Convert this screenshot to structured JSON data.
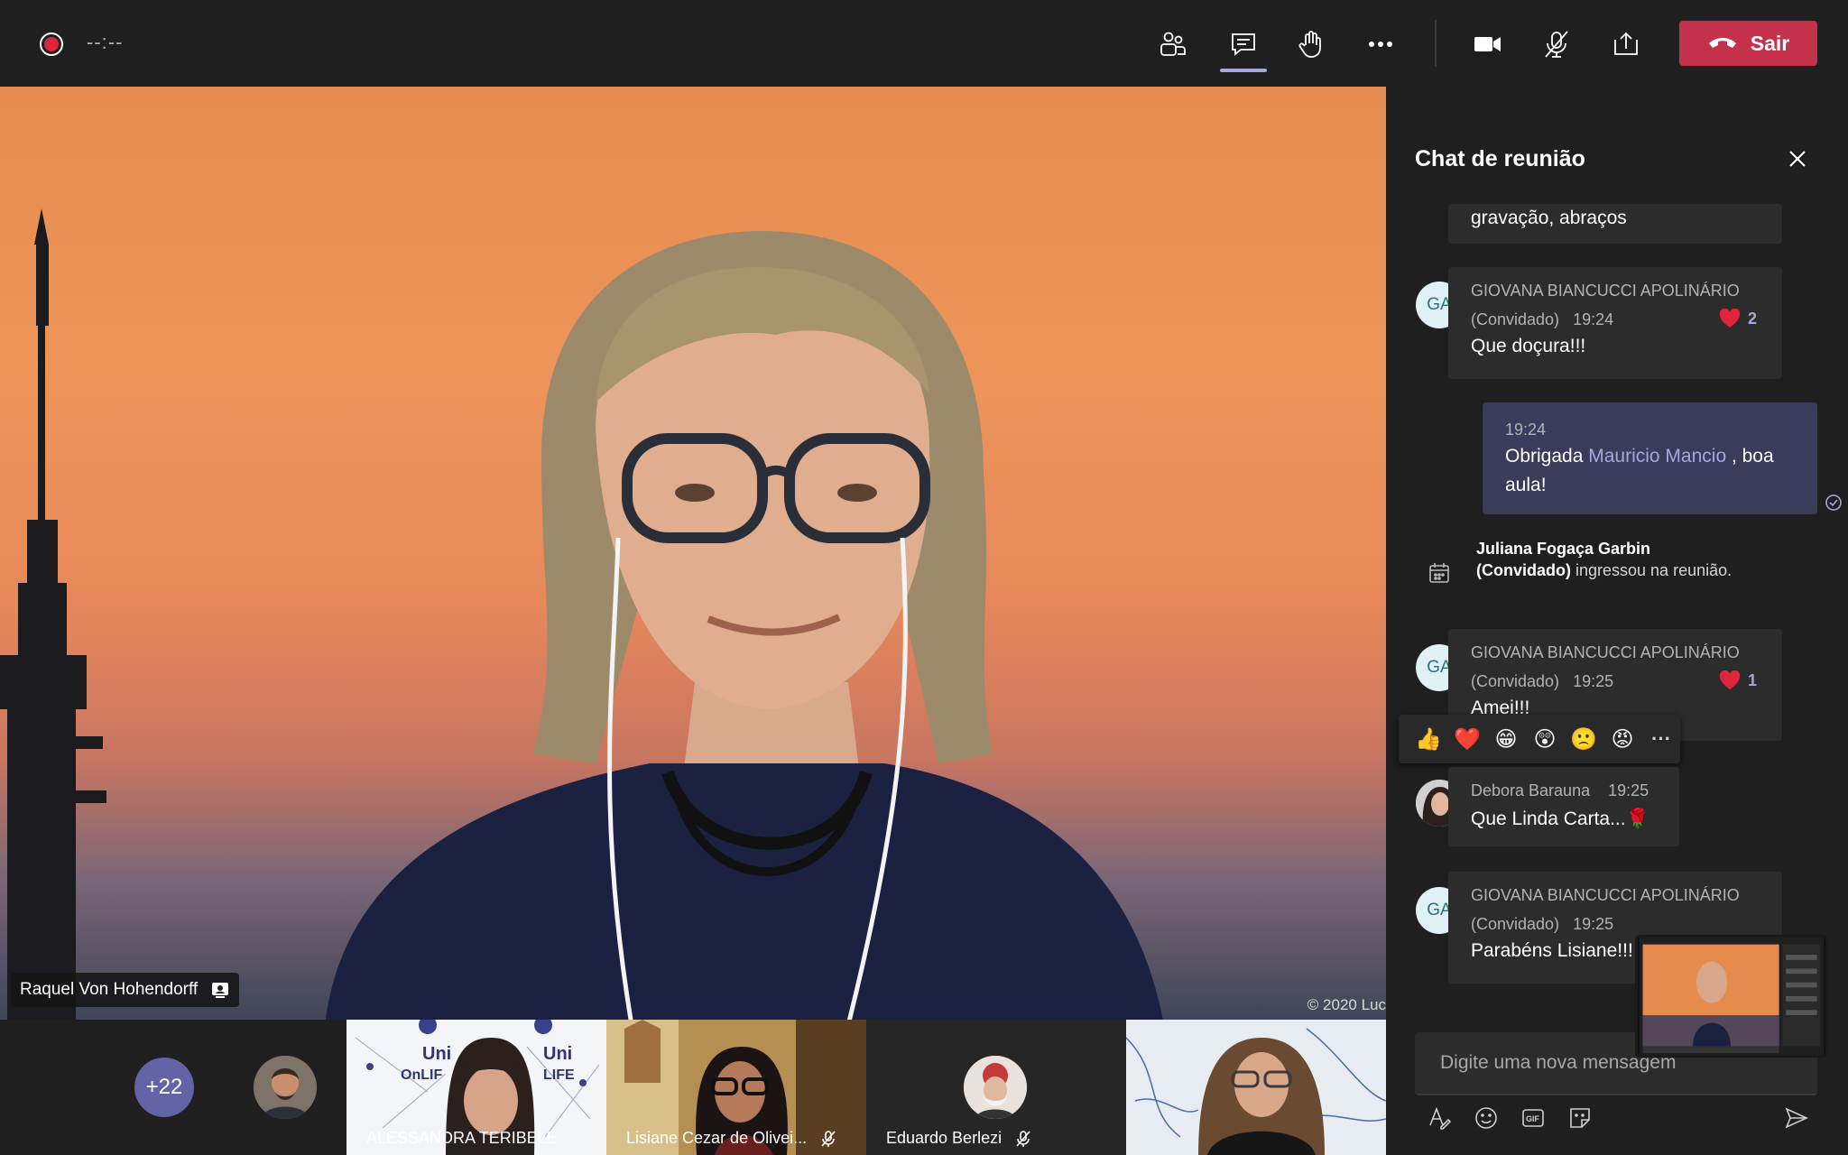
{
  "topbar": {
    "timer": "--:--",
    "leave_label": "Sair"
  },
  "main_video": {
    "speaker_name": "Raquel Von Hohendorff",
    "copyright": "© 2020 Luc"
  },
  "strip": {
    "more_count": "+22",
    "tiles": [
      {
        "name": "ALESSANDRA TERIBELE"
      },
      {
        "name": "Lisiane Cezar de Olivei..."
      },
      {
        "name": "Eduardo Berlezi"
      },
      {
        "name": ""
      }
    ]
  },
  "chat": {
    "title": "Chat de reunião",
    "messages": [
      {
        "text": "gravação, abraços"
      },
      {
        "initials": "GA",
        "author": "GIOVANA BIANCUCCI APOLINÁRIO",
        "role": "(Convidado)",
        "time": "19:24",
        "text": "Que doçura!!!",
        "reaction_count": "2"
      },
      {
        "time": "19:24",
        "text_before": "Obrigada ",
        "mention": "Mauricio Mancio",
        "text_after": " , boa aula!"
      },
      {
        "initials": "GA",
        "author": "GIOVANA BIANCUCCI APOLINÁRIO",
        "role": "(Convidado)",
        "time": "19:25",
        "text": "Amei!!!",
        "reaction_count": "1"
      },
      {
        "author": "Debora Barauna",
        "time": "19:25",
        "text": "Que Linda Carta...🌹"
      },
      {
        "initials": "GA",
        "author": "GIOVANA BIANCUCCI APOLINÁRIO",
        "role": "(Convidado)",
        "time": "19:25",
        "text": "Parabéns Lisiane!!!"
      }
    ],
    "system_message": {
      "name": "Juliana Fogaça Garbin",
      "role": "(Convidado)",
      "text": " ingressou na reunião."
    },
    "reactions": [
      "👍",
      "❤️",
      "😁",
      "😲",
      "🙁",
      "😡",
      "···"
    ],
    "compose_placeholder": "Digite uma nova mensagem"
  },
  "colors": {
    "leave": "#c4314b",
    "accent": "#6264a7",
    "mention": "#a6a7dc",
    "heart": "#e0243b"
  }
}
